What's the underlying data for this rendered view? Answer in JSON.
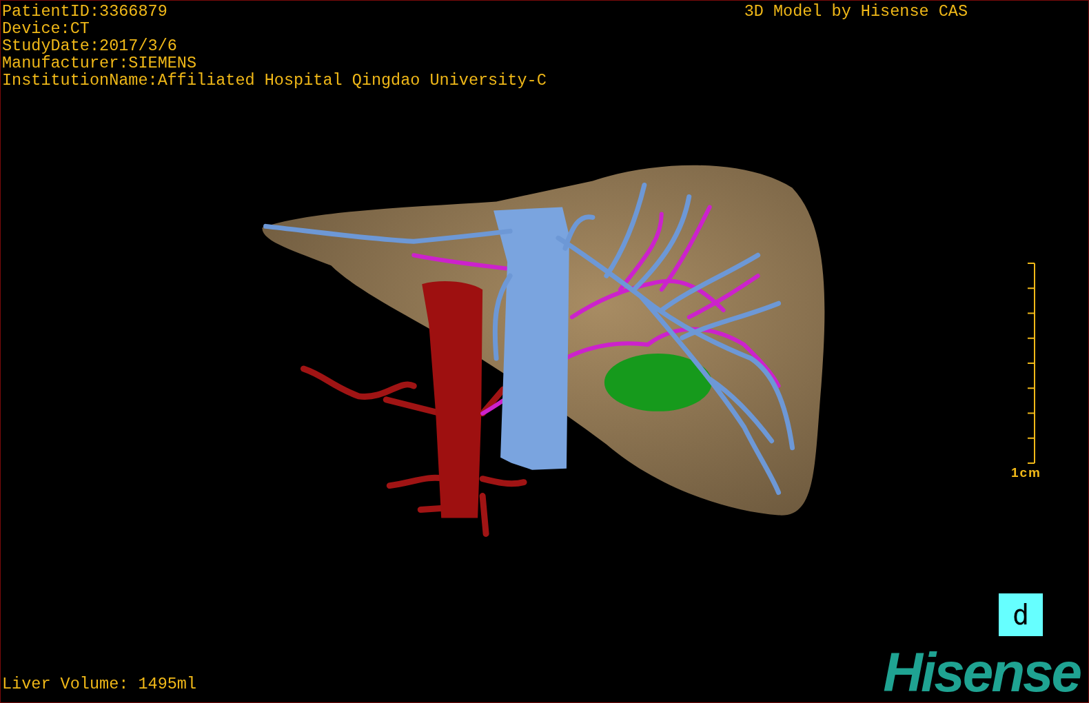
{
  "info_lines": [
    "PatientID:3366879",
    "Device:CT",
    "StudyDate:2017/3/6",
    "Manufacturer:SIEMENS",
    "InstitutionName:Affiliated Hospital Qingdao University-C"
  ],
  "title": "3D Model by Hisense CAS",
  "scale_bar": {
    "label": "1cm"
  },
  "panel_label": "d",
  "liver_volume": "Liver Volume: 1495ml",
  "logo": "Hisense"
}
